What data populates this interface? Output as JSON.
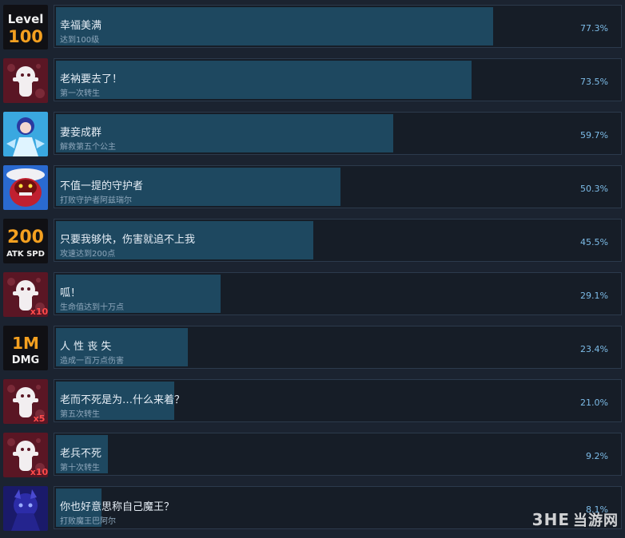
{
  "achievements": [
    {
      "title": "幸福美满",
      "desc": "达到100级",
      "percent": "77.3%",
      "fill": 0.773,
      "icon": "level-100-icon",
      "icon_lines": [
        "Level",
        "100"
      ]
    },
    {
      "title": "老衲要去了！",
      "desc": "第一次转生",
      "percent": "73.5%",
      "fill": 0.735,
      "icon": "rebirth-ghost-icon",
      "icon_lines": [
        "",
        ""
      ]
    },
    {
      "title": "妻妾成群",
      "desc": "解救第五个公主",
      "percent": "59.7%",
      "fill": 0.597,
      "icon": "princess-icon",
      "icon_lines": [
        "",
        ""
      ]
    },
    {
      "title": "不值一提的守护者",
      "desc": "打败守护者阿兹瑞尔",
      "percent": "50.3%",
      "fill": 0.503,
      "icon": "guardian-boss-icon",
      "icon_lines": [
        "",
        ""
      ]
    },
    {
      "title": "只要我够快，伤害就追不上我",
      "desc": "攻速达到200点",
      "percent": "45.5%",
      "fill": 0.455,
      "icon": "atk-spd-200-icon",
      "icon_lines": [
        "200",
        "ATK SPD"
      ]
    },
    {
      "title": "呱！",
      "desc": "生命值达到十万点",
      "percent": "29.1%",
      "fill": 0.291,
      "icon": "rebirth-ghost-x10-icon",
      "icon_lines": [
        "x10",
        ""
      ]
    },
    {
      "title": "人 性 丧 失",
      "desc": "造成一百万点伤害",
      "percent": "23.4%",
      "fill": 0.234,
      "icon": "1m-dmg-icon",
      "icon_lines": [
        "1M",
        "DMG"
      ]
    },
    {
      "title": "老而不死是为…什么来着？",
      "desc": "第五次转生",
      "percent": "21.0%",
      "fill": 0.21,
      "icon": "rebirth-ghost-x5-icon",
      "icon_lines": [
        "x5",
        ""
      ]
    },
    {
      "title": "老兵不死",
      "desc": "第十次转生",
      "percent": "9.2%",
      "fill": 0.092,
      "icon": "rebirth-ghost-x10-icon",
      "icon_lines": [
        "x10",
        ""
      ]
    },
    {
      "title": "你也好意思称自己魔王？",
      "desc": "打败魔王巴阿尔",
      "percent": "8.1%",
      "fill": 0.081,
      "icon": "demon-king-icon",
      "icon_lines": [
        "",
        ""
      ]
    }
  ],
  "watermark": {
    "brand": "3HE",
    "site": "当游网"
  },
  "colors": {
    "background": "#1b2330",
    "bar_fill": "#1e4860",
    "percent_text": "#7dbce8"
  }
}
